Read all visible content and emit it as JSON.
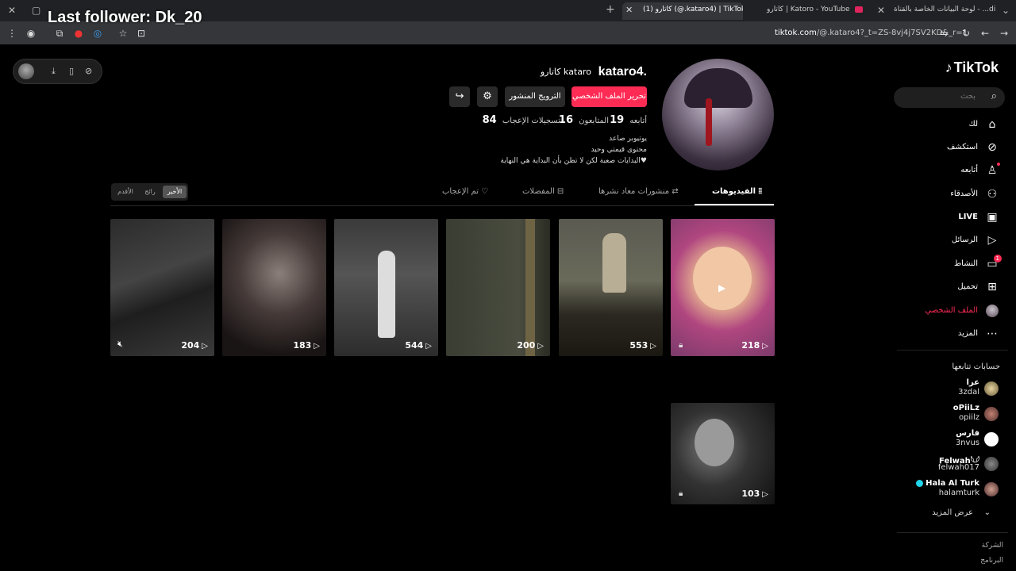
{
  "overlay": {
    "text": "Last follower: Dk_20"
  },
  "browser": {
    "tabs": [
      {
        "label": "لوحة البيانات الخاصة بالقناة - ...dio",
        "active": false
      },
      {
        "label": "كاتارو | Katoro - YouTube",
        "active": false
      },
      {
        "label": "(1) كاتارو (@.kataro4) | TikTok",
        "active": true
      }
    ],
    "url_host": "tiktok.com",
    "url_path": "/@.kataro4?_t=ZS-8vj4j7SV2KD&_r=1"
  },
  "sidebar": {
    "logo": "TikTok",
    "search_placeholder": "بحث",
    "items": [
      {
        "label": "لك",
        "icon": "home-icon",
        "active": false
      },
      {
        "label": "استكشف",
        "icon": "compass-icon",
        "active": false
      },
      {
        "label": "أتابعه",
        "icon": "following-icon",
        "active": false
      },
      {
        "label": "الأصدقاء",
        "icon": "friends-icon",
        "active": false
      },
      {
        "label": "LIVE",
        "icon": "live-icon",
        "active": false
      },
      {
        "label": "الرسائل",
        "icon": "messages-icon",
        "active": false
      },
      {
        "label": "النشاط",
        "icon": "activity-icon",
        "active": false,
        "badge": "1"
      },
      {
        "label": "تحميل",
        "icon": "upload-icon",
        "active": false
      },
      {
        "label": "الملف الشخصي",
        "icon": "profile-avatar",
        "active": true
      },
      {
        "label": "المزيد",
        "icon": "more-icon",
        "active": false
      }
    ],
    "following_title": "حسابات تتابعها",
    "following": [
      {
        "name": "عزا",
        "handle": "3zdal"
      },
      {
        "name": "oPiiLz",
        "handle": "opiilz"
      },
      {
        "name": "فارس",
        "handle": "3nvus"
      },
      {
        "name": "Felwah𓆩𓆪",
        "handle": "felwah017"
      },
      {
        "name": "Hala Al Turk",
        "handle": "halamturk",
        "verified": true
      }
    ],
    "see_more": "عرض المزيد",
    "footer": [
      "الشركة",
      "البرنامج"
    ]
  },
  "profile": {
    "username": "kataro4.",
    "nickname": "كاتارو kataro",
    "edit_button": "تحرير الملف الشخصي",
    "promote_button": "الترويج المنشور",
    "stats": {
      "following_label": "أتابعه",
      "following": "19",
      "followers_label": "المتابعون",
      "followers": "16",
      "likes_label": "تسجيلات الإعجاب",
      "likes": "84"
    },
    "bio": [
      "يوتيوبر صاعد",
      "محتوى قيمتي وحيد",
      "البدايات صعبة لكن لا تظن بأن البداية هي النهاية♥"
    ]
  },
  "tabs": {
    "videos": "الفيديوهات",
    "reposts": "منشورات معاد نشرها",
    "favorites": "المفضلات",
    "liked": "تم الإعجاب",
    "sort": [
      "الأقدم",
      "رائج",
      "الأخير"
    ]
  },
  "videos": [
    {
      "views": "218",
      "locked": true
    },
    {
      "views": "553",
      "locked": false
    },
    {
      "views": "200",
      "locked": false
    },
    {
      "views": "544",
      "locked": false
    },
    {
      "views": "183",
      "locked": false
    },
    {
      "views": "204",
      "locked": false,
      "muted": true
    },
    {
      "views": "103",
      "locked": true
    }
  ]
}
